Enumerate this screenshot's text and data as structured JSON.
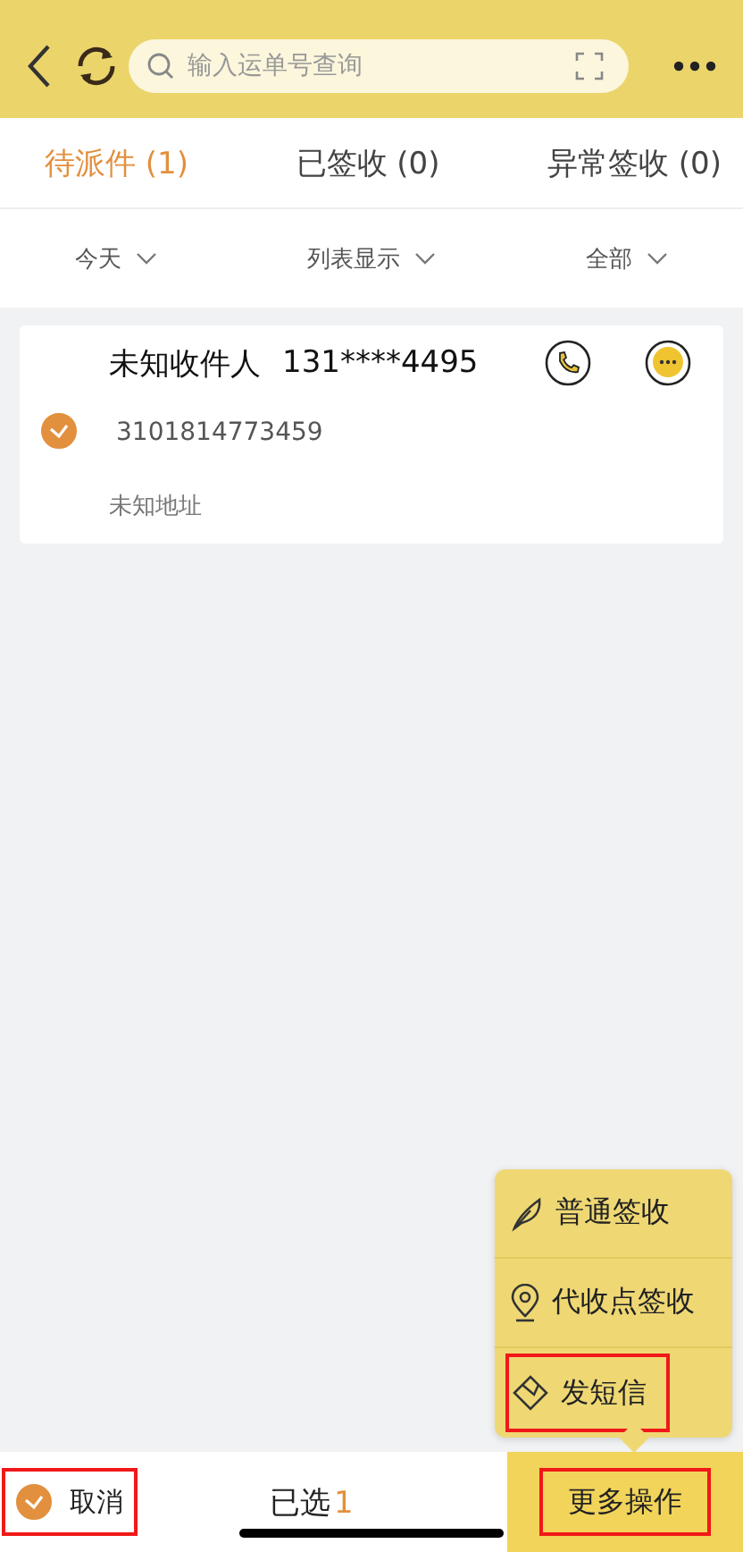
{
  "search": {
    "placeholder": "输入运单号查询"
  },
  "tabs": [
    {
      "label": "待派件 (1)",
      "selected": true
    },
    {
      "label": "已签收 (0)",
      "selected": false
    },
    {
      "label": "异常签收 (0)",
      "selected": false
    }
  ],
  "filters": [
    {
      "label": "今天"
    },
    {
      "label": "列表显示"
    },
    {
      "label": "全部"
    }
  ],
  "parcels": [
    {
      "recipient": "未知收件人",
      "phone": "131****4495",
      "tracking_number": "3101814773459",
      "address": "未知地址",
      "checked": true
    }
  ],
  "menu": [
    {
      "kind": "feather",
      "label": "普通签收",
      "highlighted": false
    },
    {
      "kind": "pin",
      "label": "代收点签收",
      "highlighted": false
    },
    {
      "kind": "envelope",
      "label": "发短信",
      "highlighted": true
    }
  ],
  "bottom_bar": {
    "cancel": {
      "label": "取消",
      "checked": true,
      "highlighted": true
    },
    "selected_label": "已选",
    "selected_count": "1",
    "more": {
      "label": "更多操作",
      "highlighted": true
    }
  }
}
